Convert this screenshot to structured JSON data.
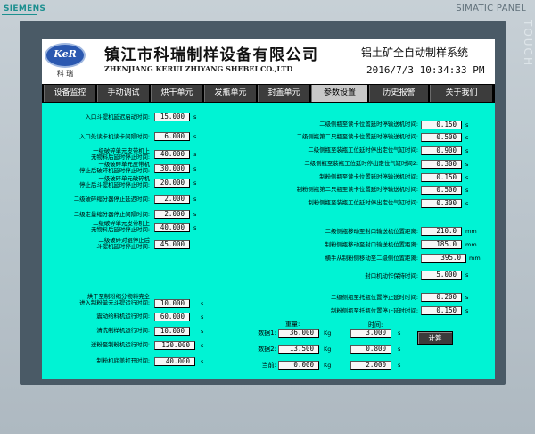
{
  "device": {
    "brand": "SIEMENS",
    "panel": "SIMATIC PANEL",
    "touch": "TOUCH"
  },
  "header": {
    "logo_text": "KeR",
    "logo_sub": "科 瑞",
    "company_cn": "镇江市科瑞制样设备有限公司",
    "company_en": "ZHENJIANG KERUI ZHIYANG SHEBEI CO.,LTD",
    "system_title": "铝土矿全自动制样系统",
    "datetime": "2016/7/3 10:34:33 PM"
  },
  "nav": {
    "tabs": [
      {
        "label": "设备监控"
      },
      {
        "label": "手动调试"
      },
      {
        "label": "烘干单元"
      },
      {
        "label": "发瓶单元"
      },
      {
        "label": "封盖单元"
      },
      {
        "label": "参数设置"
      },
      {
        "label": "历史报警"
      },
      {
        "label": "关于我们"
      }
    ],
    "active": "参数设置"
  },
  "left_params": [
    {
      "label": "入口斗提机延迟启动时间:",
      "value": "15.000",
      "unit": "s"
    },
    {
      "label": "入口处读卡机读卡间隔时间:",
      "value": "6.000",
      "unit": "s"
    },
    {
      "label": "一级破碎单元皮带机上\n无物料后延时停止时间:",
      "value": "40.000",
      "unit": "s"
    },
    {
      "label": "一级破碎单元皮带机\n停止后破碎机延时停止时间:",
      "value": "30.000",
      "unit": "s"
    },
    {
      "label": "一级破碎单元破碎机\n停止后斗提机延时停止时间:",
      "value": "20.000",
      "unit": "s"
    },
    {
      "label": "二级破碎缩分器停止延迟时间:",
      "value": "2.000",
      "unit": "s"
    },
    {
      "label": "二级定量缩分器停止间隔时间:",
      "value": "2.000",
      "unit": "s"
    },
    {
      "label": "二级破碎单元皮带机上\n无物料后延时停止时间:",
      "value": "40.000",
      "unit": "s"
    },
    {
      "label": "二级破碎对辊停止后\n斗提机延时停止时间:",
      "value": "45.000",
      "unit": ""
    }
  ],
  "left_params_lower": [
    {
      "label": "烘干至制粉缩分物料完全\n进入制粉单元斗提运行时间:",
      "value": "10.000",
      "unit": "s"
    },
    {
      "label": "震动给料机运行时间:",
      "value": "60.000",
      "unit": "s"
    },
    {
      "label": "清洗制样机运行时间:",
      "value": "10.000",
      "unit": "s"
    },
    {
      "label": "送粉至制粉机运行时间:",
      "value": "120.000",
      "unit": "s"
    },
    {
      "label": "制粉机底盖打开时间:",
      "value": "40.000",
      "unit": "s"
    }
  ],
  "right_params": [
    {
      "label": "二级侧瓶至读卡位置延时停输送机时间:",
      "value": "0.150",
      "unit": "s"
    },
    {
      "label": "二级侧瓶第二只瓶至读卡位置延时停输送机时间:",
      "value": "0.500",
      "unit": "s"
    },
    {
      "label": "二级侧瓶至装瓶工位延时停出定位气缸时间:",
      "value": "0.900",
      "unit": "s"
    },
    {
      "label": "二级侧瓶至装瓶工位延时停出定位气缸时间2:",
      "value": "0.300",
      "unit": "s"
    },
    {
      "label": "制粉侧瓶至读卡位置延时停输送机时间:",
      "value": "0.150",
      "unit": "s"
    },
    {
      "label": "制粉侧瓶第二只瓶至读卡位置延时停输送机时间:",
      "value": "0.500",
      "unit": "s"
    },
    {
      "label": "制粉侧瓶至装瓶工位延时停出定位气缸时间:",
      "value": "0.300",
      "unit": "s"
    }
  ],
  "right_positions": [
    {
      "label": "二级侧瓶移动至封口输送机位置距离:",
      "value": "210.0",
      "unit": "mm"
    },
    {
      "label": "制粉侧瓶移动至封口输送机位置距离:",
      "value": "185.0",
      "unit": "mm"
    },
    {
      "label": "横手从制粉侧移动至二级侧位置距离:",
      "value": "395.0",
      "unit": "mm"
    },
    {
      "label": "封口机动作保持时间:",
      "value": "5.000",
      "unit": "s"
    }
  ],
  "right_lower": [
    {
      "label": "二级侧瓶至托瓶位置停止延时时间:",
      "value": "0.200",
      "unit": "s"
    },
    {
      "label": "制粉侧瓶至托瓶位置停止延时时间:",
      "value": "0.150",
      "unit": "s"
    }
  ],
  "calc": {
    "weight_header": "重量:",
    "time_header": "时间:",
    "rows": [
      {
        "label": "数据1:",
        "weight": "36.000",
        "weight_unit": "Kg",
        "time": "3.000",
        "time_unit": "s"
      },
      {
        "label": "数据2:",
        "weight": "13.500",
        "weight_unit": "Kg",
        "time": "0.800",
        "time_unit": "s"
      },
      {
        "label": "当前:",
        "weight": "0.000",
        "weight_unit": "Kg",
        "time": "2.000",
        "time_unit": "s"
      }
    ],
    "button": "计算"
  }
}
